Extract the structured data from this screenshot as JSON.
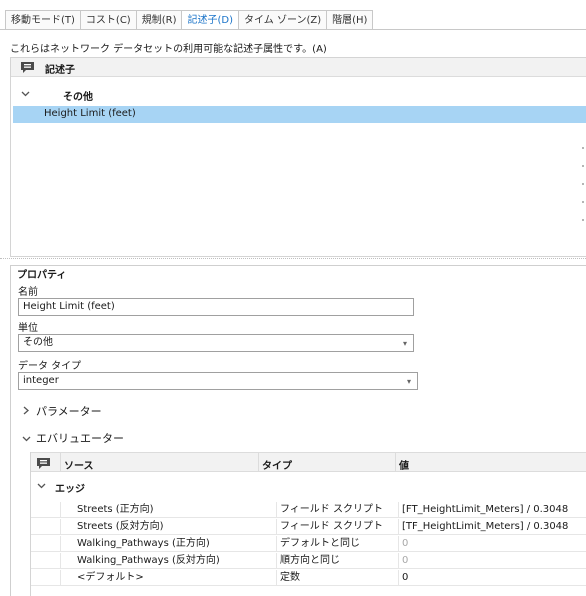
{
  "tabs": [
    {
      "label": "移動モード(T)",
      "active": false
    },
    {
      "label": "コスト(C)",
      "active": false
    },
    {
      "label": "規制(R)",
      "active": false
    },
    {
      "label": "記述子(D)",
      "active": true
    },
    {
      "label": "タイム ゾーン(Z)",
      "active": false
    },
    {
      "label": "階層(H)",
      "active": false
    }
  ],
  "description": "これらはネットワーク データセットの利用可能な記述子属性です。(A)",
  "descriptor_list": {
    "header": "記述子",
    "group": "その他",
    "selected_item": "Height Limit (feet)"
  },
  "properties": {
    "legend": "プロパティ",
    "name_label": "名前",
    "name_value": "Height Limit (feet)",
    "units_label": "単位",
    "units_value": "その他",
    "datatype_label": "データ タイプ",
    "datatype_value": "integer",
    "parameters_label": "パラメーター",
    "evaluators_label": "エバリュエーター"
  },
  "evaluators": {
    "columns": [
      "ソース",
      "タイプ",
      "値"
    ],
    "group": "エッジ",
    "rows": [
      {
        "source": "Streets (正方向)",
        "type": "フィールド スクリプト",
        "value": "[FT_HeightLimit_Meters] / 0.3048",
        "muted": false
      },
      {
        "source": "Streets (反対方向)",
        "type": "フィールド スクリプト",
        "value": "[TF_HeightLimit_Meters] / 0.3048",
        "muted": false
      },
      {
        "source": "Walking_Pathways (正方向)",
        "type": "デフォルトと同じ",
        "value": "0",
        "muted": true
      },
      {
        "source": "Walking_Pathways (反対方向)",
        "type": "順方向と同じ",
        "value": "0",
        "muted": true
      },
      {
        "source": "<デフォルト>",
        "type": "定数",
        "value": "0",
        "muted": false
      }
    ]
  },
  "icons": {
    "list_header": "comment-icon",
    "expand": "chevron-down-icon",
    "collapsed": "chevron-right-icon",
    "dropdown": "dropdown-arrow-icon"
  },
  "colors": {
    "active_tab": "#1a73c8",
    "selection": "#a7d4f4",
    "muted_text": "#a8a8a8"
  }
}
